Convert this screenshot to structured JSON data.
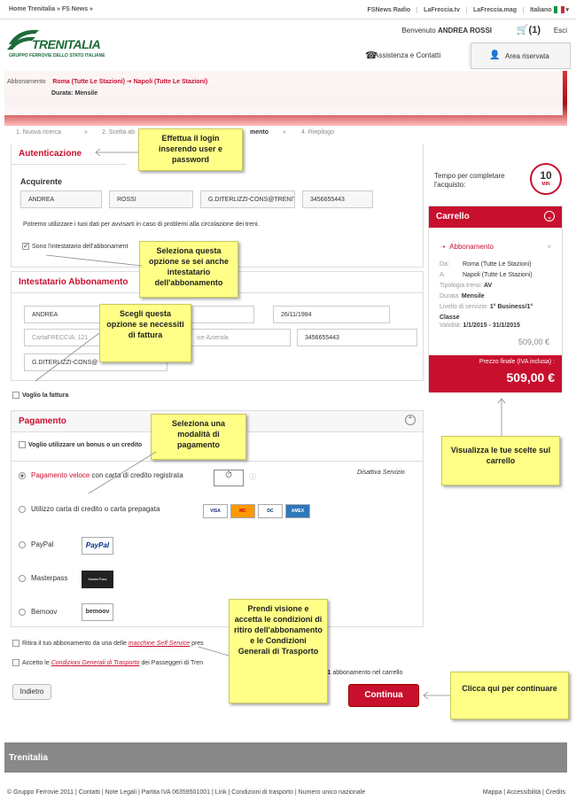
{
  "topbar": {
    "left": "Home Trenitalia »   FS News »",
    "links": [
      "FSNews Radio",
      "LaFreccia.tv",
      "LaFreccia.mag",
      "Italiano"
    ]
  },
  "brand": {
    "name": "TRENITALIA",
    "sub": "GRUPPO FERROVIE DELLO STATO ITALIANE"
  },
  "header": {
    "welcome": "Benvenuto",
    "user": "ANDREA ROSSI",
    "cart": "(1)",
    "logout": "Esci",
    "assist": "Assistenza e Contatti",
    "area": "Area riservata"
  },
  "crumb": {
    "type": "Abbonamento",
    "from": "Roma (Tutte Le Stazioni)",
    "to": "Napoli (Tutte Le Stazioni)",
    "duration": "Durata: Mensile"
  },
  "steps": [
    "1. Nuova ricerca",
    "»",
    "2. Scelta ab",
    "mento",
    "»",
    "4. Riepilogo"
  ],
  "auth": {
    "title": "Autenticazione",
    "acquirente": "Acquirente",
    "name": "ANDREA",
    "surname": "ROSSI",
    "email": "G.DITERLIZZI-CONS@TRENIT.",
    "phone": "3456655443",
    "privacy": "Potremo utilizzare i tuoi dati per avvisarti in caso di problemi alla circolazione dei treni.",
    "holder": "Sono l'intestatario dell'abbonament"
  },
  "holder": {
    "title": "Intestatario Abbonamento",
    "name": "ANDREA",
    "birth": "26/11/1984",
    "carta": "CartaFRECCIA: 121",
    "azienda": "ice Azienda",
    "phone": "3456655443",
    "email": "G.DITERLIZZI-CONS@",
    "invoice": "Voglio la fattura"
  },
  "payment": {
    "title": "Pagamento",
    "bonus": "Voglio utilizzare un bonus o un credito",
    "fast": "Pagamento veloce",
    "fast_rest": " con carta di credito registrata",
    "disable": "Disattiva Servizio",
    "card": "Utilizzo carta di credito o carta prepagata",
    "cards": [
      "VISA",
      "MC",
      "DC",
      "AMEX"
    ],
    "paypal": "PayPal",
    "paypal_logo": "PayPal",
    "masterpass": "Masterpass",
    "masterpass_logo": "MasterPass",
    "bemoov": "Bemoov",
    "bemoov_logo": "bemoov"
  },
  "terms": {
    "ritira_a": "Ritira il tuo abbonamento da una delle ",
    "ritira_link": "macchine Self Service",
    "ritira_b": " pres",
    "accetto_a": "Accetto le ",
    "accetto_link": "Condizioni Generali di Trasporto",
    "accetto_b": " dei Passeggeri di Tren",
    "count_a": "i ",
    "count_num": "1",
    "count_b": " abbonamento nel carrello"
  },
  "buttons": {
    "back": "Indietro",
    "continue": "Continua"
  },
  "timer": {
    "label": "Tempo per completare l'acquisto:",
    "value": "10",
    "unit": "MIN"
  },
  "cart": {
    "title": "Carrello",
    "item": "Abbonamento",
    "da_l": "Da:",
    "da": "Roma (Tutte Le Stazioni)",
    "a_l": "A:",
    "a": "Napoli (Tutte Le Stazioni)",
    "tipo_l": "Tipologia treno:",
    "tipo": "AV",
    "durata_l": "Durata:",
    "durata": "Mensile",
    "livello_l": "Livello di servizio:",
    "livello": "1° Business/1°",
    "classe": "Classe",
    "validita_l": "Validità:",
    "validita": "1/1/2015 - 31/1/2015",
    "price": "509,00 €",
    "final_label": "Prezzo finale (IVA inclusa) :",
    "final": "509,00 €"
  },
  "notes": {
    "n1": "Effettua il login inserendo user e password",
    "n2": "Seleziona questa opzione se sei anche intestatario dell'abbonamento",
    "n3": "Scegli questa opzione se necessiti di fattura",
    "n4": "Seleziona una modalità di pagamento",
    "n5": "Prendi visione e accetta le condizioni di ritiro dell'abbonamento e le Condizioni Generali di Trasporto",
    "n6": "Visualizza le tue scelte sul carrello",
    "n7": "Clicca qui per continuare"
  },
  "footer": {
    "title": "Trenitalia",
    "left": "© Gruppo Ferrovie 2011 | Contatti | Note Legali | Partita IVA 06359501001 | Link | Condizioni di trasporto | Numero unico nazionale",
    "right": "Mappa | Accessibilità | Credits"
  }
}
